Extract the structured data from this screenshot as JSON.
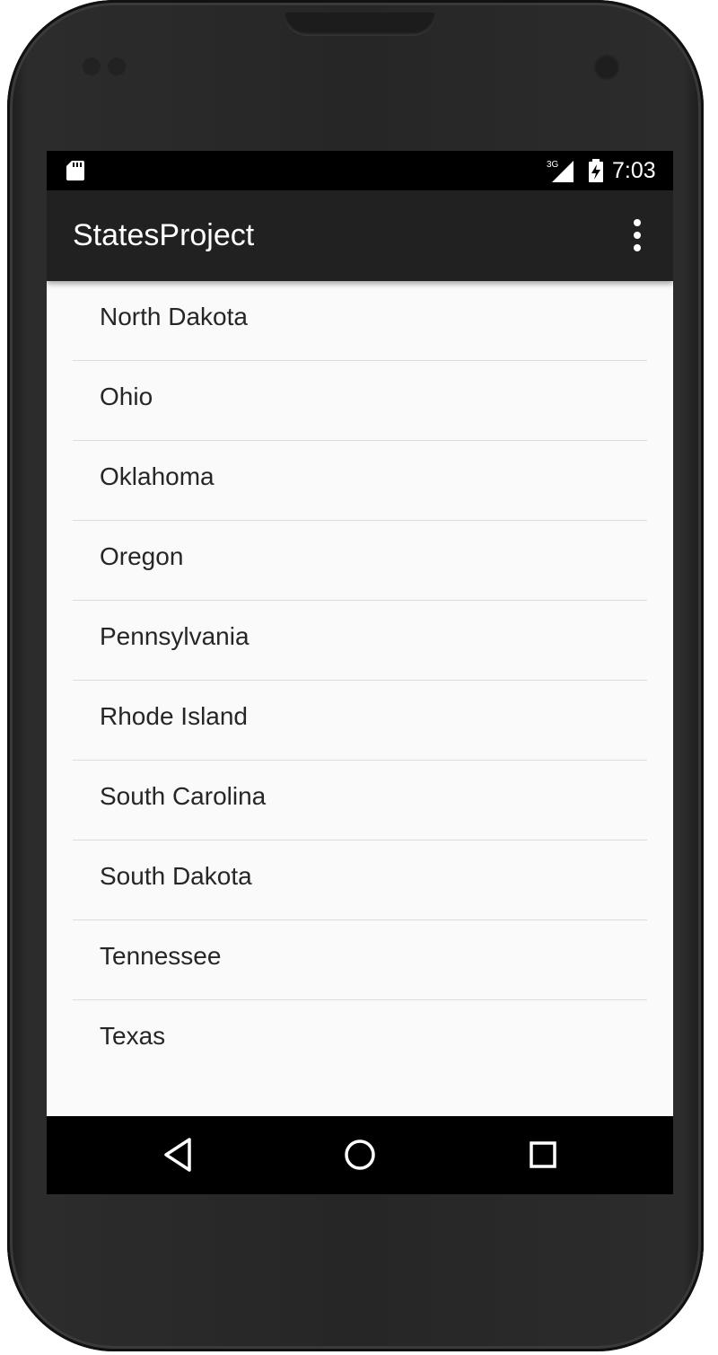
{
  "status_bar": {
    "time": "7:03",
    "network_label": "3G",
    "icons": [
      "sd-card-icon",
      "signal-icon",
      "battery-charging-icon"
    ]
  },
  "app_bar": {
    "title": "StatesProject",
    "menu_icon": "overflow-menu-icon"
  },
  "states": [
    {
      "label": "North Dakota"
    },
    {
      "label": "Ohio"
    },
    {
      "label": "Oklahoma"
    },
    {
      "label": "Oregon"
    },
    {
      "label": "Pennsylvania"
    },
    {
      "label": "Rhode Island"
    },
    {
      "label": "South Carolina"
    },
    {
      "label": "South Dakota"
    },
    {
      "label": "Tennessee"
    },
    {
      "label": "Texas"
    }
  ],
  "nav_bar": {
    "icons": [
      "back-icon",
      "home-icon",
      "recents-icon"
    ]
  },
  "colors": {
    "app_bar": "#212121",
    "status_bar": "#000000",
    "list_background": "#fafafa",
    "divider": "#dcdcdc",
    "list_text": "#262626"
  }
}
